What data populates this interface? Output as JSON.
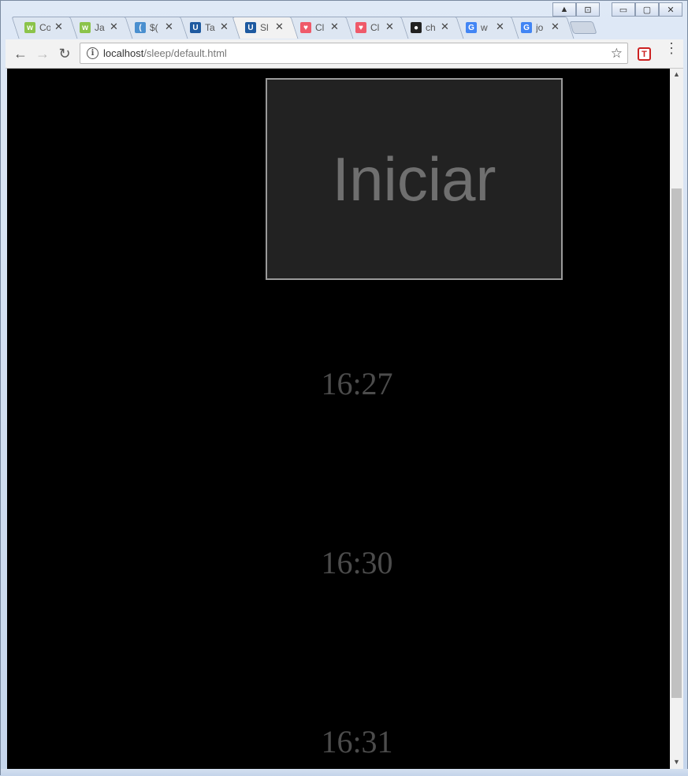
{
  "browser": {
    "tabs": [
      {
        "title": "Co",
        "favicon": "wa-icon",
        "color": "#8bc34a",
        "glyph": "w"
      },
      {
        "title": "Ja",
        "favicon": "wa-icon",
        "color": "#8bc34a",
        "glyph": "w"
      },
      {
        "title": "$(",
        "favicon": "jquery-icon",
        "color": "#4a8fcf",
        "glyph": "("
      },
      {
        "title": "Ta",
        "favicon": "u-icon",
        "color": "#1e5aa0",
        "glyph": "U"
      },
      {
        "title": "Sl",
        "favicon": "u-icon",
        "color": "#1e5aa0",
        "glyph": "U"
      },
      {
        "title": "Cl",
        "favicon": "pocket-icon",
        "color": "#ef5a6a",
        "glyph": "♥"
      },
      {
        "title": "Cl",
        "favicon": "pocket-icon",
        "color": "#ef5a6a",
        "glyph": "♥"
      },
      {
        "title": "ch",
        "favicon": "github-icon",
        "color": "#222222",
        "glyph": "●"
      },
      {
        "title": "w",
        "favicon": "google-icon",
        "color": "#4285f4",
        "glyph": "G"
      },
      {
        "title": "jo",
        "favicon": "google-icon",
        "color": "#4285f4",
        "glyph": "G"
      }
    ],
    "active_tab_index": 4,
    "close_glyph": "✕",
    "url_host": "localhost",
    "url_path": "/sleep/default.html",
    "back_glyph": "←",
    "forward_glyph": "→",
    "reload_glyph": "↻",
    "star_glyph": "☆",
    "extension_glyph": "T",
    "menu_glyph": "⋮",
    "window_controls": {
      "minimize": "▭",
      "maximize": "▢",
      "close": "✕",
      "up": "▲",
      "pin": "⊡"
    }
  },
  "page": {
    "start_button_label": "Iniciar",
    "times": [
      "16:27",
      "16:30",
      "16:31"
    ]
  },
  "scrollbar": {
    "up": "▲",
    "down": "▼"
  }
}
